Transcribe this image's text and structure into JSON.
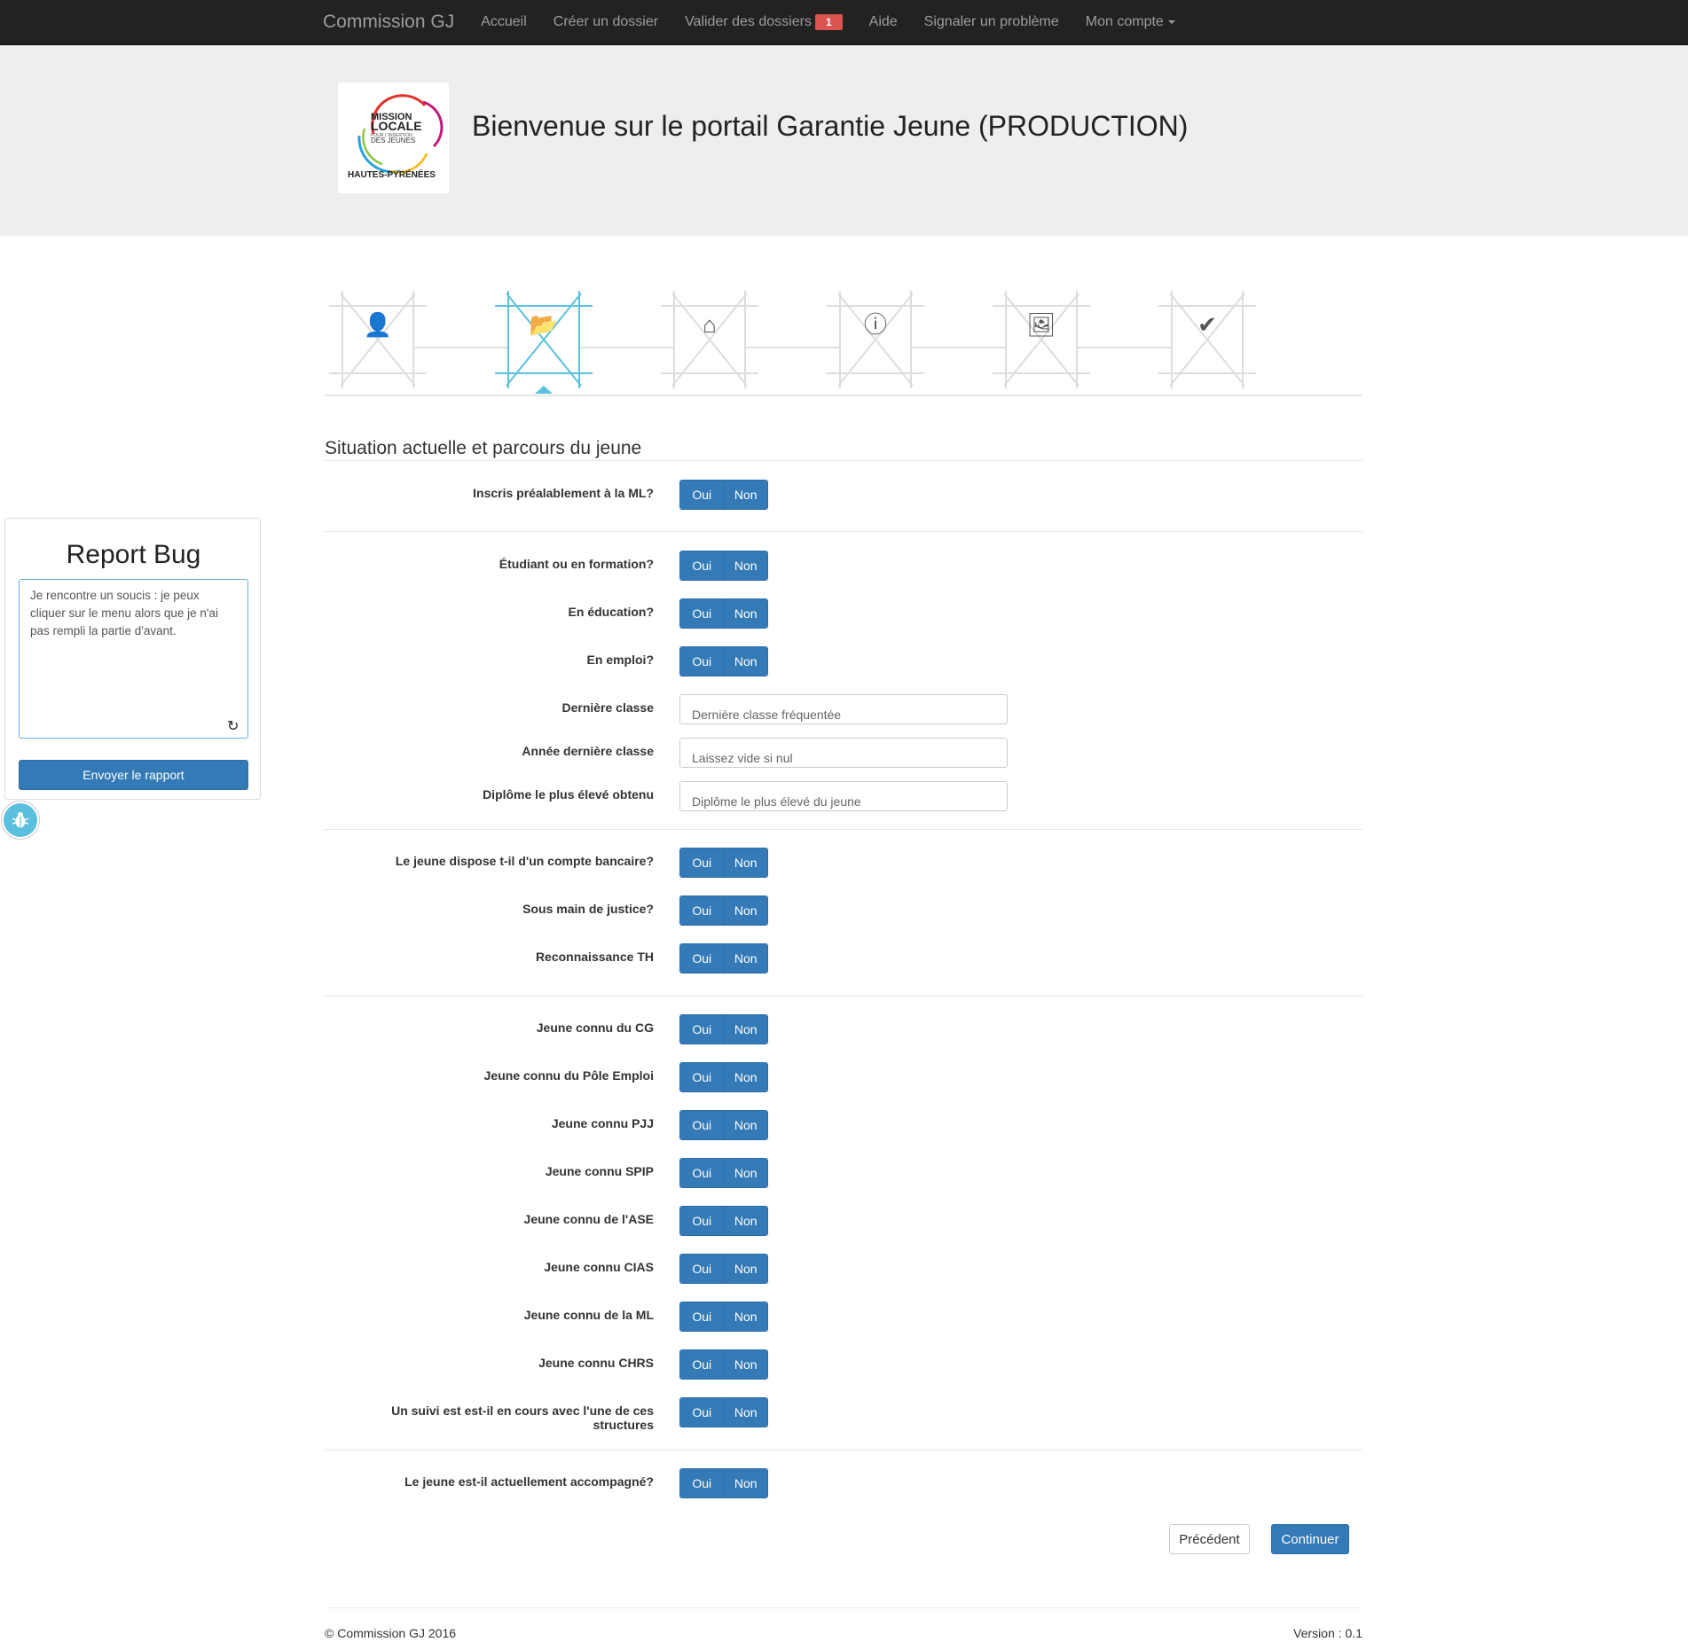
{
  "navbar": {
    "brand": "Commission GJ",
    "links": [
      {
        "label": "Accueil"
      },
      {
        "label": "Créer un dossier"
      },
      {
        "label": "Valider des dossiers",
        "badge": "1"
      },
      {
        "label": "Aide"
      },
      {
        "label": "Signaler un problème"
      },
      {
        "label": "Mon compte"
      }
    ]
  },
  "header": {
    "title": "Bienvenue sur le portail Garantie Jeune (PRODUCTION)",
    "logo": {
      "line1": "MISSION",
      "line2": "LOCALE",
      "line3": "POUR L'INSERTION",
      "line4": "DES JEUNES",
      "line5": "HAUTES-PYRÉNÉES"
    }
  },
  "wizard": {
    "active_index": 1,
    "steps": [
      {
        "icon": "user-icon"
      },
      {
        "icon": "folder-open-icon"
      },
      {
        "icon": "home-icon"
      },
      {
        "icon": "info-sign-icon"
      },
      {
        "icon": "picture-icon"
      },
      {
        "icon": "ok-icon"
      }
    ]
  },
  "form": {
    "section_title": "Situation actuelle et parcours du jeune",
    "toggle_yes": "Oui",
    "toggle_no": "Non",
    "q_inscrit": "Inscris préalablement à la ML?",
    "q_etudiant": "Étudiant ou en formation?",
    "q_education": "En éducation?",
    "q_emploi": "En emploi?",
    "f_derniere_classe": {
      "label": "Dernière classe",
      "placeholder": "Dernière classe fréquentée"
    },
    "f_annee_classe": {
      "label": "Année dernière classe",
      "placeholder": "Laissez vide si nul"
    },
    "f_diplome": {
      "label": "Diplôme le plus élevé obtenu",
      "placeholder": "Diplôme le plus élevé du jeune"
    },
    "q_banque": "Le jeune dispose t-il d'un compte bancaire?",
    "q_justice": "Sous main de justice?",
    "q_th": "Reconnaissance TH",
    "q_cg": "Jeune connu du CG",
    "q_pole": "Jeune connu du Pôle Emploi",
    "q_pjj": "Jeune connu PJJ",
    "q_spip": "Jeune connu SPIP",
    "q_ase": "Jeune connu de l'ASE",
    "q_cias": "Jeune connu CIAS",
    "q_ml": "Jeune connu de la ML",
    "q_chrs": "Jeune connu CHRS",
    "q_suivi_1": "Un suivi est est-il en cours avec l'une de ces",
    "q_suivi_2": "structures",
    "q_accompagne": "Le jeune est-il actuellement accompagné?"
  },
  "actions": {
    "previous": "Précédent",
    "continue": "Continuer"
  },
  "footer": {
    "copyright": "© Commission GJ 2016",
    "version": "Version : 0.1"
  },
  "bug_report": {
    "title": "Report Bug",
    "message": "Je rencontre un soucis : je peux cliquer sur le menu alors que je n'ai pas rempli la partie d'avant.",
    "send": "Envoyer le rapport"
  },
  "colors": {
    "primary": "#337ab7",
    "accent": "#5bc0de",
    "badge": "#d9534f",
    "navbar": "#222222"
  }
}
